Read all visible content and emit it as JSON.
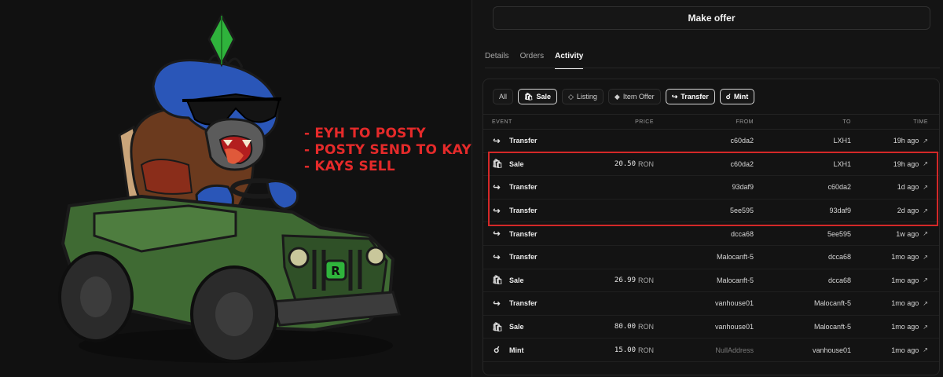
{
  "annotation": {
    "lines": [
      "- EYH TO POSTY",
      "- POSTY SEND TO KAYS",
      "- KAYS SELL"
    ],
    "color": "#e52a2a"
  },
  "art": {
    "badge_letter": "R"
  },
  "panel": {
    "make_offer_label": "Make offer",
    "tabs": [
      {
        "label": "Details",
        "active": false
      },
      {
        "label": "Orders",
        "active": false
      },
      {
        "label": "Activity",
        "active": true
      }
    ]
  },
  "filters": [
    {
      "label": "All",
      "icon": "",
      "selected": false
    },
    {
      "label": "Sale",
      "icon": "bag-icon",
      "selected": true
    },
    {
      "label": "Listing",
      "icon": "tag-icon",
      "selected": false
    },
    {
      "label": "Item Offer",
      "icon": "offer-icon",
      "selected": false
    },
    {
      "label": "Transfer",
      "icon": "transfer-icon",
      "selected": true
    },
    {
      "label": "Mint",
      "icon": "mint-icon",
      "selected": true
    }
  ],
  "table": {
    "headers": {
      "event": "EVENT",
      "price": "PRICE",
      "from": "FROM",
      "to": "TO",
      "time": "TIME"
    },
    "rows": [
      {
        "event": "Transfer",
        "icon": "transfer-icon",
        "price": "",
        "unit": "",
        "from": "c60da2",
        "to": "LXH1",
        "time": "19h ago"
      },
      {
        "event": "Sale",
        "icon": "bag-icon",
        "price": "20.50",
        "unit": "RON",
        "from": "c60da2",
        "to": "LXH1",
        "time": "19h ago"
      },
      {
        "event": "Transfer",
        "icon": "transfer-icon",
        "price": "",
        "unit": "",
        "from": "93daf9",
        "to": "c60da2",
        "time": "1d ago"
      },
      {
        "event": "Transfer",
        "icon": "transfer-icon",
        "price": "",
        "unit": "",
        "from": "5ee595",
        "to": "93daf9",
        "time": "2d ago"
      },
      {
        "event": "Transfer",
        "icon": "transfer-icon",
        "price": "",
        "unit": "",
        "from": "dcca68",
        "to": "5ee595",
        "time": "1w ago"
      },
      {
        "event": "Transfer",
        "icon": "transfer-icon",
        "price": "",
        "unit": "",
        "from": "Malocanft-5",
        "to": "dcca68",
        "time": "1mo ago"
      },
      {
        "event": "Sale",
        "icon": "bag-icon",
        "price": "26.99",
        "unit": "RON",
        "from": "Malocanft-5",
        "to": "dcca68",
        "time": "1mo ago"
      },
      {
        "event": "Transfer",
        "icon": "transfer-icon",
        "price": "",
        "unit": "",
        "from": "vanhouse01",
        "to": "Malocanft-5",
        "time": "1mo ago"
      },
      {
        "event": "Sale",
        "icon": "bag-icon",
        "price": "80.00",
        "unit": "RON",
        "from": "vanhouse01",
        "to": "Malocanft-5",
        "time": "1mo ago"
      },
      {
        "event": "Mint",
        "icon": "mint-icon",
        "price": "15.00",
        "unit": "RON",
        "from": "NullAddress",
        "from_muted": true,
        "to": "vanhouse01",
        "time": "1mo ago"
      }
    ]
  },
  "highlight_color": "#d42828"
}
